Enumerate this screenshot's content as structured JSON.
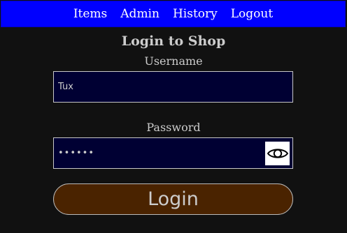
{
  "nav": {
    "items": [
      {
        "label": "Items"
      },
      {
        "label": "Admin"
      },
      {
        "label": "History"
      },
      {
        "label": "Logout"
      }
    ]
  },
  "form": {
    "title": "Login to Shop",
    "username_label": "Username",
    "username_value": "Tux",
    "password_label": "Password",
    "password_value": "••••••",
    "show_password_icon": "eye-icon",
    "login_label": "Login"
  },
  "colors": {
    "nav_background": "#0000ff",
    "page_background": "#111111",
    "input_background": "#000033",
    "login_button_background": "#4a2300"
  }
}
